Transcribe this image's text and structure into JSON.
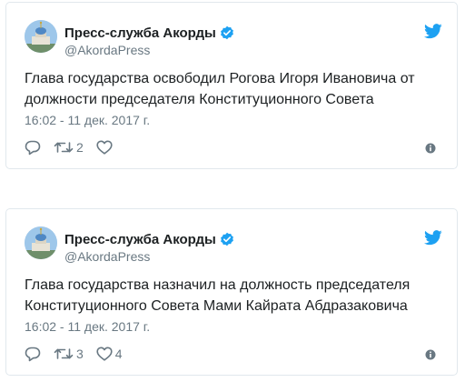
{
  "colors": {
    "brand": "#1da1f2",
    "muted": "#697882",
    "text": "#1c2022",
    "border": "#e1e8ed"
  },
  "tweets": [
    {
      "display_name": "Пресс-служба Акорды",
      "handle": "@AkordaPress",
      "text": "Глава государства освободил Рогова Игоря Ивановича от должности председателя Конституционного Совета",
      "timestamp": "16:02 - 11 дек. 2017 г.",
      "retweet_count": "2",
      "like_count": "",
      "icons": [
        "verified-icon",
        "twitter-bird-icon",
        "reply-icon",
        "retweet-icon",
        "heart-icon",
        "info-icon"
      ]
    },
    {
      "display_name": "Пресс-служба Акорды",
      "handle": "@AkordaPress",
      "text": "Глава государства назначил на должность председателя Конституционного Совета Мами Кайрата Абдразаковича",
      "timestamp": "16:02 - 11 дек. 2017 г.",
      "retweet_count": "3",
      "like_count": "4",
      "icons": [
        "verified-icon",
        "twitter-bird-icon",
        "reply-icon",
        "retweet-icon",
        "heart-icon",
        "info-icon"
      ]
    }
  ]
}
